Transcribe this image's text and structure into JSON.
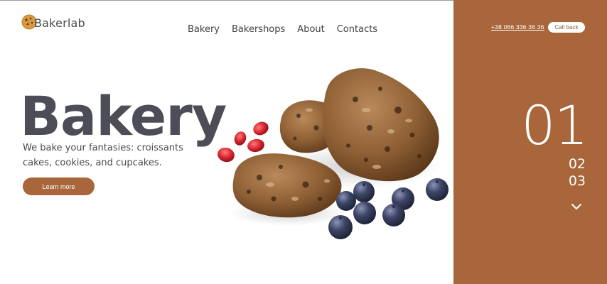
{
  "logo": {
    "text": "Bakerlab",
    "icon": "cookie-icon"
  },
  "nav": {
    "items": [
      {
        "label": "Bakery"
      },
      {
        "label": "Bakershops"
      },
      {
        "label": "About"
      },
      {
        "label": "Contacts"
      }
    ]
  },
  "header": {
    "phone": "+38 066 336 36 36",
    "callback_label": "Call back"
  },
  "hero": {
    "title": "Bakery",
    "subtitle": "We bake your fantasies: croissants cakes, cookies, and cupcakes.",
    "button_label": "Learn more",
    "image": "cookies-with-blueberries-and-pomegranate"
  },
  "slider": {
    "current": "01",
    "next": [
      "02",
      "03"
    ],
    "down_icon": "chevron-down-icon"
  },
  "colors": {
    "accent": "#a8663a",
    "text": "#4d4d57",
    "background": "#ffffff"
  }
}
